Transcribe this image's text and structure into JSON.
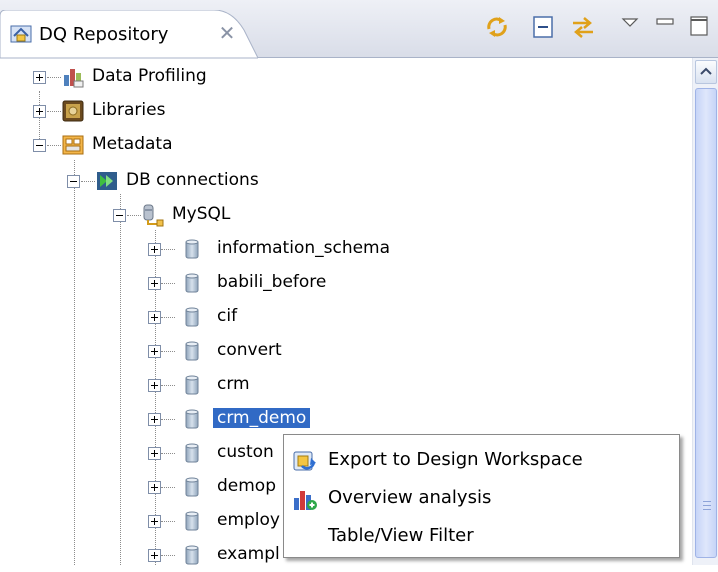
{
  "view": {
    "title": "DQ Repository",
    "close_glyph": "✕",
    "toolbar": [
      "sync-icon",
      "collapse-all-icon",
      "link-with-editor-icon",
      "view-menu-icon",
      "minimize-icon",
      "maximize-icon"
    ]
  },
  "tree": {
    "nodes": [
      {
        "label": "Data Profiling",
        "icon": "data-profiling-icon",
        "expanded": false
      },
      {
        "label": "Libraries",
        "icon": "libraries-icon",
        "expanded": false
      },
      {
        "label": "Metadata",
        "icon": "metadata-icon",
        "expanded": true
      },
      {
        "label": "DB connections",
        "icon": "db-connections-icon",
        "expanded": true
      },
      {
        "label": "MySQL",
        "icon": "mysql-connection-icon",
        "expanded": true
      },
      {
        "label": "information_schema",
        "icon": "database-icon",
        "expanded": false
      },
      {
        "label": "babili_before",
        "icon": "database-icon",
        "expanded": false
      },
      {
        "label": "cif",
        "icon": "database-icon",
        "expanded": false
      },
      {
        "label": "convert",
        "icon": "database-icon",
        "expanded": false
      },
      {
        "label": "crm",
        "icon": "database-icon",
        "expanded": false
      },
      {
        "label": "crm_demo",
        "icon": "database-icon",
        "expanded": false,
        "selected": true
      },
      {
        "label": "custon",
        "icon": "database-icon",
        "expanded": false
      },
      {
        "label": "demop",
        "icon": "database-icon",
        "expanded": false
      },
      {
        "label": "employ",
        "icon": "database-icon",
        "expanded": false
      },
      {
        "label": "exampl",
        "icon": "database-icon",
        "expanded": false
      }
    ]
  },
  "context_menu": {
    "items": [
      {
        "label": "Export to Design Workspace",
        "icon": "export-icon"
      },
      {
        "label": "Overview analysis",
        "icon": "overview-analysis-icon"
      },
      {
        "label": "Table/View Filter",
        "icon": ""
      }
    ]
  },
  "colors": {
    "selection": "#316ac5",
    "header_gradient_top": "#eef0f6",
    "header_gradient_bottom": "#d9dde8",
    "scrollbar_thumb": "#c6d4f7"
  }
}
